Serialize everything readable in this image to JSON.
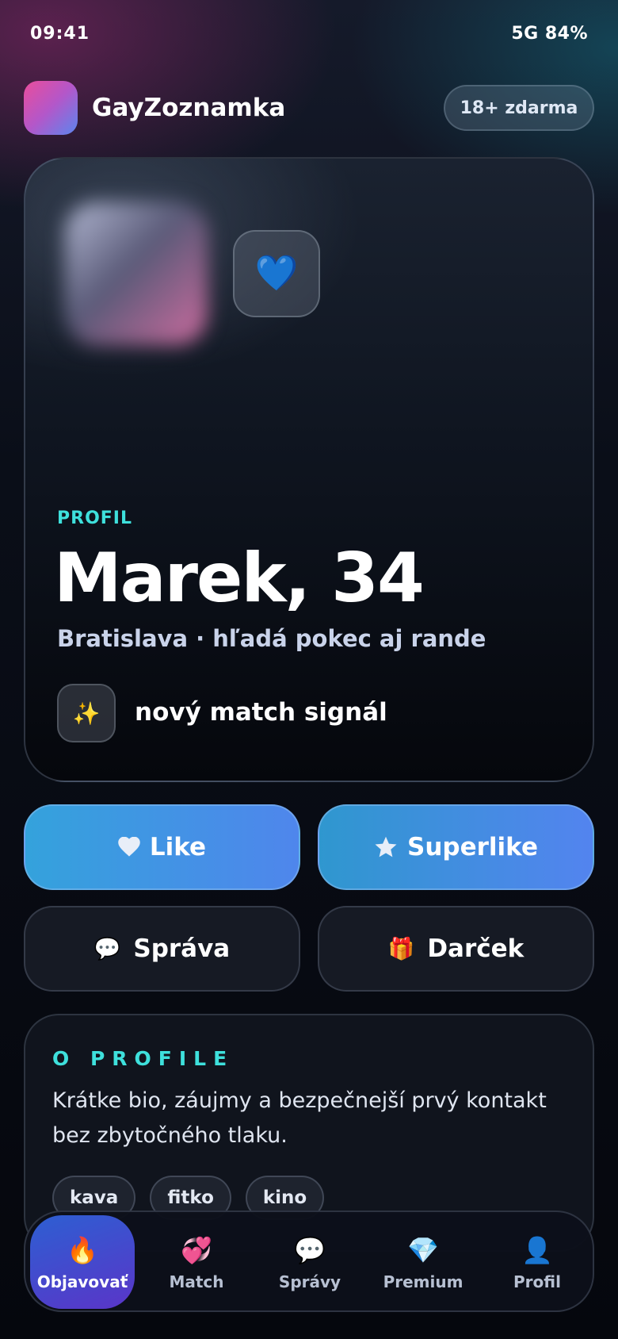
{
  "status_bar": {
    "time": "09:41",
    "network": "5G 84%"
  },
  "header": {
    "app_name": "GayZoznamka",
    "badge": "18+ zdarma"
  },
  "profile": {
    "heart_emoji": "💙",
    "section_label": "PROFIL",
    "name_age": "Marek, 34",
    "subtitle": "Bratislava · hľadá pokec aj rande",
    "signal_icon": "✨",
    "signal_text": "nový match signál"
  },
  "actions": {
    "like": "Like",
    "superlike": "Superlike",
    "message_icon": "💬",
    "message": "Správa",
    "gift_icon": "🎁",
    "gift": "Darček"
  },
  "about": {
    "title": "O PROFILE",
    "bio": "Krátke bio, záujmy a bezpečnejší prvý kontakt bez zbytočného tlaku.",
    "tags": [
      "kava",
      "fitko",
      "kino"
    ]
  },
  "nav": {
    "items": [
      {
        "icon": "🔥",
        "label": "Objavovať",
        "active": true
      },
      {
        "icon": "💞",
        "label": "Match",
        "active": false
      },
      {
        "icon": "💬",
        "label": "Správy",
        "active": false
      },
      {
        "icon": "💎",
        "label": "Premium",
        "active": false
      },
      {
        "icon": "👤",
        "label": "Profil",
        "active": false
      }
    ]
  },
  "colors": {
    "accent_teal": "#3ee0dc",
    "like_gradient_start": "#34a2dc",
    "like_gradient_end": "#4f86ec",
    "nav_active_start": "#2d5fd2",
    "nav_active_end": "#5a35c8"
  }
}
